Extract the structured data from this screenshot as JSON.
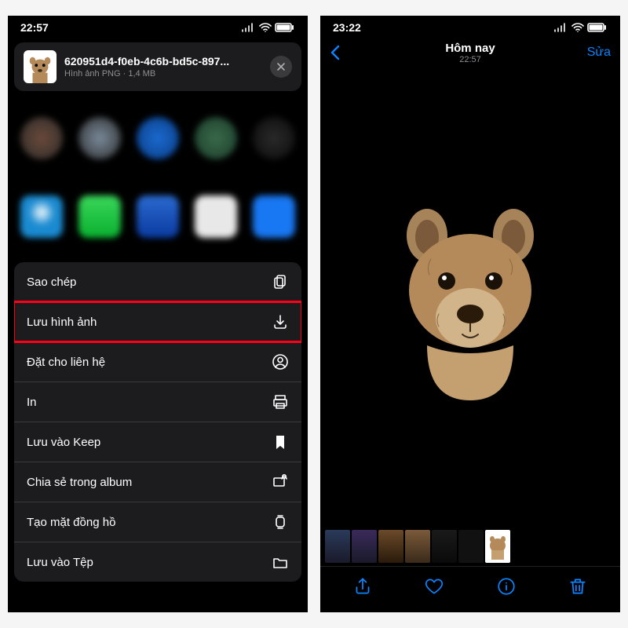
{
  "left": {
    "status_time": "22:57",
    "file_name": "620951d4-f0eb-4c6b-bd5c-897...",
    "file_type": "Hình ảnh PNG",
    "file_size": "1,4 MB",
    "actions": {
      "copy": "Sao chép",
      "save_image": "Lưu hình ảnh",
      "assign_contact": "Đặt cho liên hệ",
      "print": "In",
      "save_keep": "Lưu vào Keep",
      "share_album": "Chia sẻ trong album",
      "watch_face": "Tạo mặt đồng hồ",
      "save_files": "Lưu vào Tệp"
    }
  },
  "right": {
    "status_time": "23:22",
    "nav_title": "Hôm nay",
    "nav_subtitle": "22:57",
    "edit_label": "Sửa"
  },
  "colors": {
    "accent": "#0a84ff",
    "highlight": "#ff0019"
  }
}
